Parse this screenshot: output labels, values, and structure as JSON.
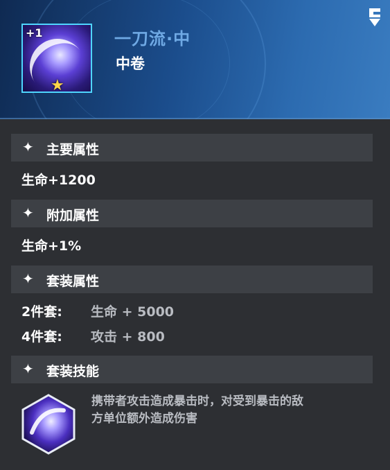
{
  "item": {
    "name": "一刀流·中",
    "rank": "中卷",
    "enhance_level": "+1",
    "star_icon": "star-icon",
    "header_icon": "swap-icon",
    "accent_color": "#4fd6ff",
    "name_color": "#6fa9e4"
  },
  "sections": {
    "main": {
      "title": "主要属性",
      "value": "生命+1200"
    },
    "extra": {
      "title": "附加属性",
      "value": "生命+1%"
    },
    "set": {
      "title": "套装属性",
      "rows": [
        {
          "key": "2件套:",
          "value": "生命  + 5000"
        },
        {
          "key": "4件套:",
          "value": "攻击  + 800"
        }
      ]
    },
    "skill": {
      "title": "套装技能",
      "line1": "携带者攻击造成暴击时，对受到暴击的敌",
      "line2": "方单位额外造成伤害"
    }
  }
}
